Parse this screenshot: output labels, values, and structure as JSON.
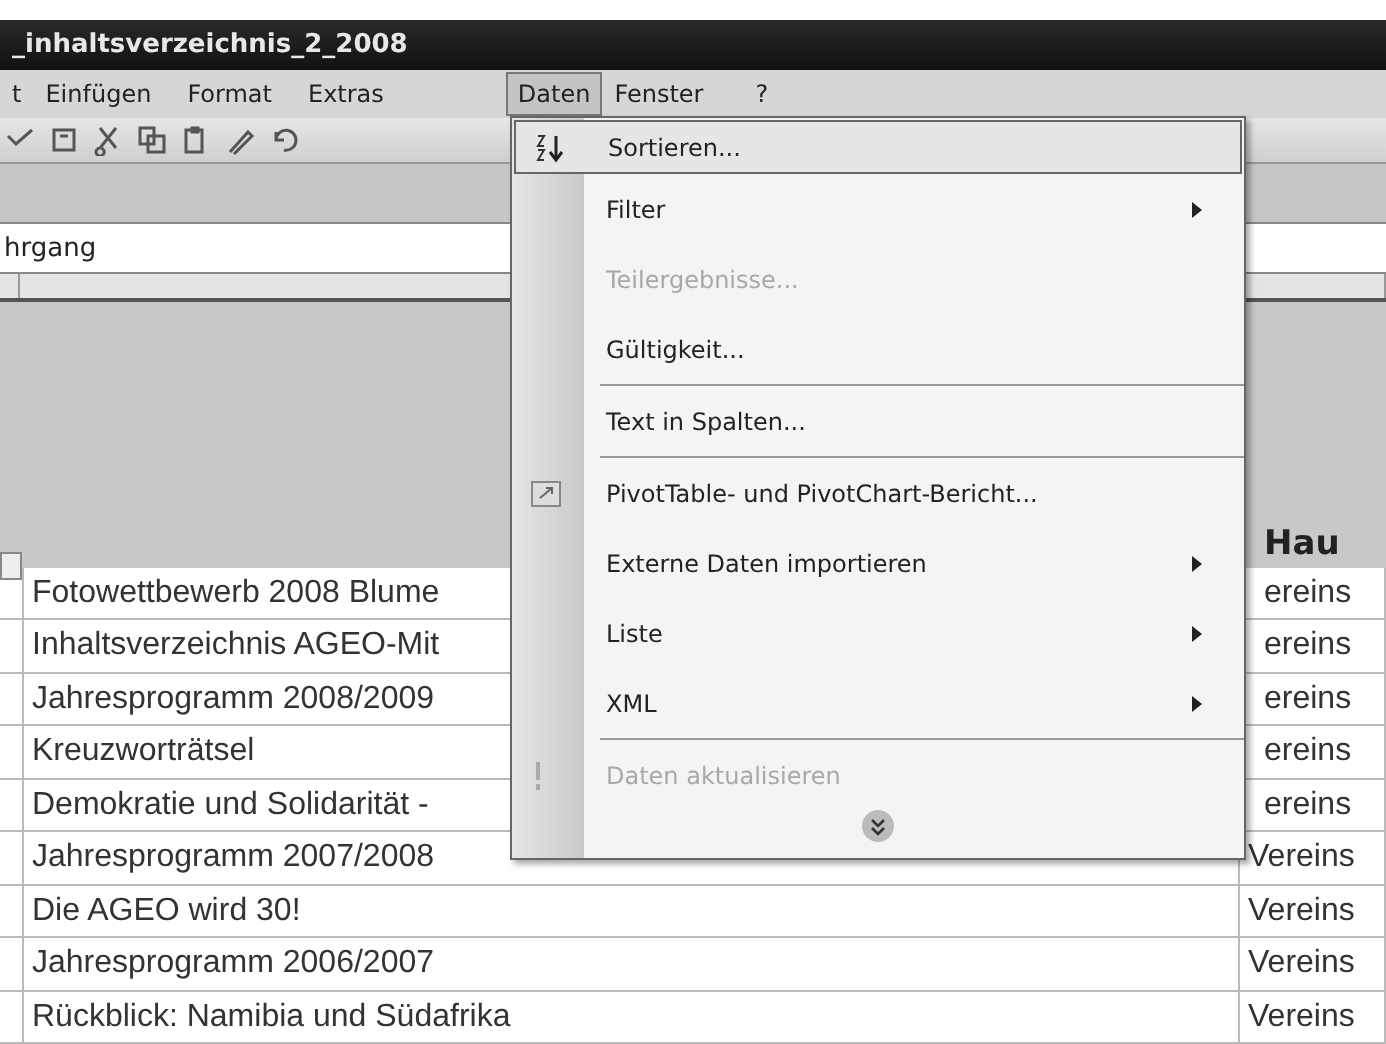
{
  "window": {
    "title": "_inhaltsverzeichnis_2_2008"
  },
  "menubar": [
    {
      "label": "t",
      "selected": false
    },
    {
      "label": "Einfügen",
      "selected": false
    },
    {
      "label": "Format",
      "selected": false
    },
    {
      "label": "Extras",
      "selected": false
    },
    {
      "label": "Daten",
      "selected": true
    },
    {
      "label": "Fenster",
      "selected": false
    },
    {
      "label": "?",
      "selected": false
    }
  ],
  "formula_bar": {
    "value": "hrgang"
  },
  "header": {
    "column_3": "Hau"
  },
  "rows": [
    {
      "column_2": "Fotowettbewerb 2008 Blume",
      "column_3": "ereins"
    },
    {
      "column_2": "Inhaltsverzeichnis AGEO-Mit",
      "column_3": "ereins"
    },
    {
      "column_2": "Jahresprogramm 2008/2009",
      "column_3": "ereins"
    },
    {
      "column_2": "Kreuzworträtsel",
      "column_3": "ereins"
    },
    {
      "column_2": "Demokratie und Solidarität -",
      "column_3": "ereins"
    },
    {
      "column_2": "Jahresprogramm 2007/2008",
      "column_3": "Vereins"
    },
    {
      "column_2": "Die AGEO wird 30!",
      "column_3": "Vereins"
    },
    {
      "column_2": "Jahresprogramm 2006/2007",
      "column_3": "Vereins"
    },
    {
      "column_2": "Rückblick: Namibia und Südafrika",
      "column_3": "Vereins"
    }
  ],
  "menu": {
    "items": [
      {
        "label": "Sortieren...",
        "highlighted": true,
        "disabled": false,
        "submenu": false,
        "separator_before": false
      },
      {
        "label": "Filter",
        "highlighted": false,
        "disabled": false,
        "submenu": true,
        "separator_before": false
      },
      {
        "label": "Teilergebnisse...",
        "highlighted": false,
        "disabled": true,
        "submenu": false,
        "separator_before": false
      },
      {
        "label": "Gültigkeit...",
        "highlighted": false,
        "disabled": false,
        "submenu": false,
        "separator_before": false
      },
      {
        "label": "Text in Spalten...",
        "highlighted": false,
        "disabled": false,
        "submenu": false,
        "separator_before": true
      },
      {
        "label": "PivotTable- und PivotChart-Bericht...",
        "highlighted": false,
        "disabled": false,
        "submenu": false,
        "separator_before": true
      },
      {
        "label": "Externe Daten importieren",
        "highlighted": false,
        "disabled": false,
        "submenu": true,
        "separator_before": false
      },
      {
        "label": "Liste",
        "highlighted": false,
        "disabled": false,
        "submenu": true,
        "separator_before": false
      },
      {
        "label": "XML",
        "highlighted": false,
        "disabled": false,
        "submenu": true,
        "separator_before": false
      },
      {
        "label": "Daten aktualisieren",
        "highlighted": false,
        "disabled": true,
        "submenu": false,
        "separator_before": true
      }
    ],
    "expand": true
  }
}
